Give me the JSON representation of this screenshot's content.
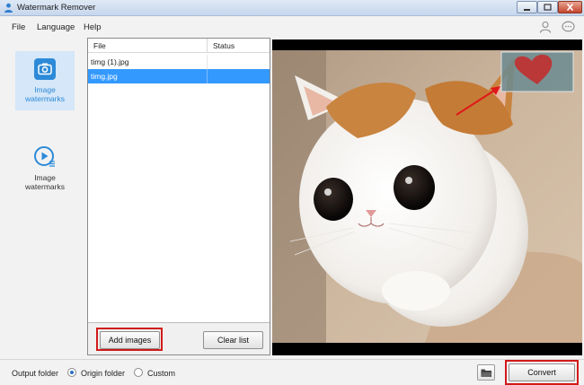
{
  "window": {
    "title": "Watermark Remover"
  },
  "menu": {
    "file": "File",
    "language": "Language",
    "help": "Help"
  },
  "header_icons": {
    "user": "user-icon",
    "feedback": "chat-bubble-icon"
  },
  "sidebar": {
    "items": [
      {
        "label": "Image watermarks",
        "icon": "camera-icon",
        "active": true
      },
      {
        "label": "Image watermarks",
        "icon": "video-play-icon",
        "active": false
      }
    ]
  },
  "file_list": {
    "columns": {
      "file": "File",
      "status": "Status"
    },
    "rows": [
      {
        "file": "timg (1).jpg",
        "status": "",
        "selected": false
      },
      {
        "file": "timg.jpg",
        "status": "",
        "selected": true
      }
    ]
  },
  "buttons": {
    "add_images": "Add images",
    "clear_list": "Clear list",
    "convert": "Convert"
  },
  "output": {
    "label": "Output folder",
    "options": [
      "Origin folder",
      "Custom"
    ],
    "selected": "Origin folder"
  },
  "colors": {
    "accent": "#2d8ad8",
    "selection": "#3399ff",
    "highlight": "#d11a1a"
  }
}
